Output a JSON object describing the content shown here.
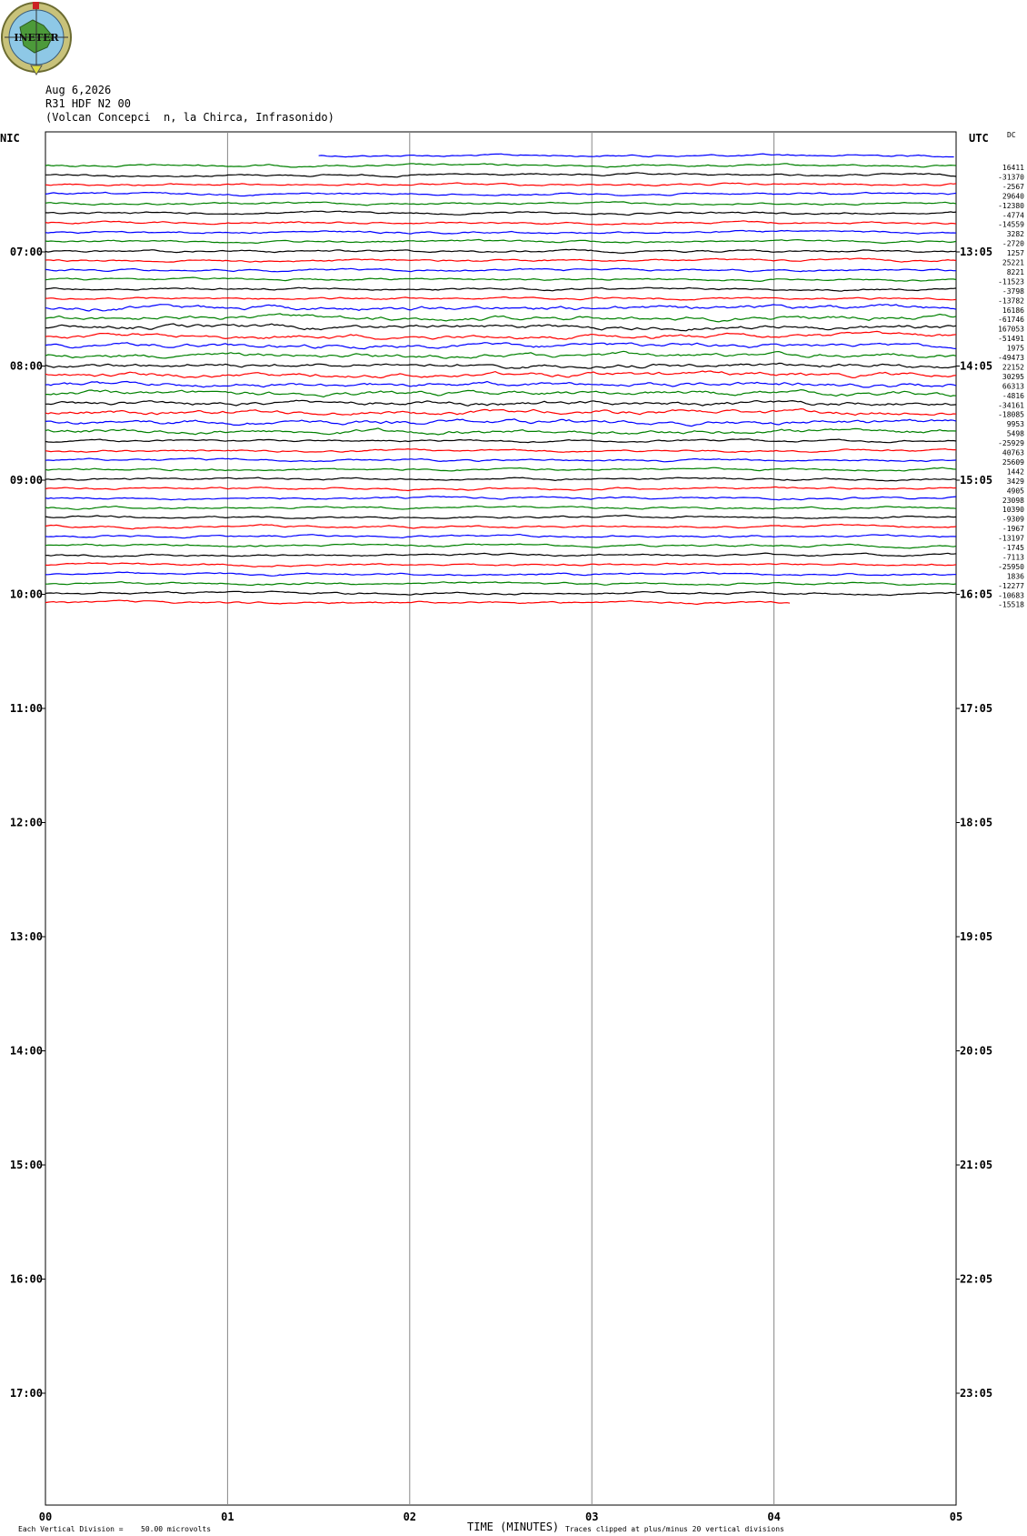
{
  "logo": {
    "text": "INETER"
  },
  "header": {
    "date": "Aug 6,2026",
    "station": "R31 HDF N2 00",
    "location": "(Volcan Concepci  n, la Chirca, Infrasonido)"
  },
  "chart_data": {
    "type": "line",
    "title": "",
    "xlabel": "TIME (MINUTES)",
    "ylabel": "",
    "left_axis_label": "NIC",
    "right_axis_label": "UTC",
    "dc_label": "DC",
    "xlim": [
      0,
      5
    ],
    "x_ticks": [
      "00",
      "01",
      "02",
      "03",
      "04",
      "05"
    ],
    "left_hour_labels": [
      "07:00",
      "08:00",
      "09:00",
      "10:00",
      "11:00",
      "12:00",
      "13:00",
      "14:00",
      "15:00",
      "16:00",
      "17:00"
    ],
    "right_hour_labels": [
      "13:05",
      "14:05",
      "15:05",
      "16:05",
      "17:05",
      "18:05",
      "19:05",
      "20:05",
      "21:05",
      "22:05",
      "23:05"
    ],
    "trace_colors": [
      "#0000ff",
      "#008000",
      "#000000",
      "#ff0000"
    ],
    "first_trace_start_min": 1.5,
    "last_trace_end_min": 4.1,
    "dc_offsets": [
      "16411",
      "-31370",
      "-2567",
      "29640",
      "-12380",
      "-4774",
      "-14559",
      "3282",
      "-2720",
      "1257",
      "25221",
      "8221",
      "-11523",
      "-3798",
      "-13782",
      "16186",
      "-61746",
      "167053",
      "-51491",
      "1975",
      "-49473",
      "22152",
      "30295",
      "66313",
      "-4816",
      "-34161",
      "-18085",
      "9953",
      "5498",
      "-25929",
      "40763",
      "25609",
      "1442",
      "3429",
      "4905",
      "23098",
      "10390",
      "-9309",
      "-1967",
      "-13197",
      "-1745",
      "-7113",
      "-25950",
      "1836",
      "-12277",
      "-10683",
      "-15518"
    ],
    "grid": "vertical",
    "annotations": {
      "division": "Each Vertical Division =",
      "microvolts": "50.00 microvolts",
      "clipped": "Traces clipped at plus/minus 20 vertical divisions"
    }
  }
}
